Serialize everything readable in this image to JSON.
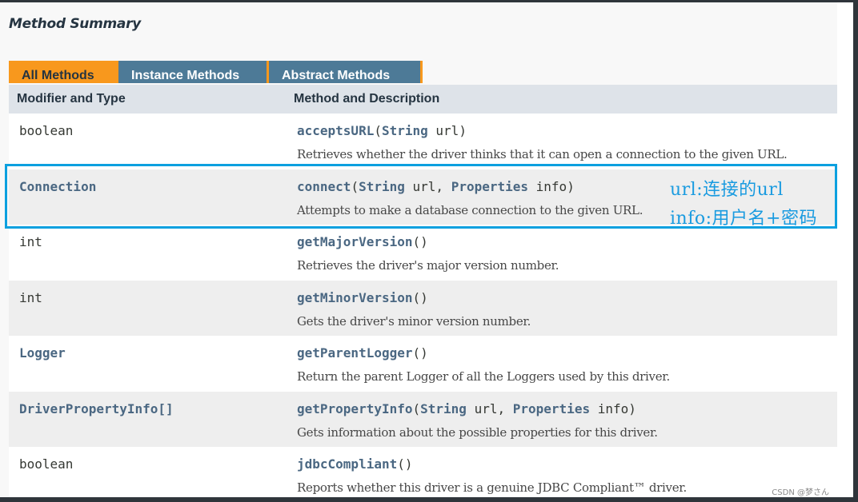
{
  "section": {
    "title": "Method Summary"
  },
  "tabs": [
    {
      "label": "All Methods",
      "active": true
    },
    {
      "label": "Instance Methods",
      "active": false
    },
    {
      "label": "Abstract Methods",
      "active": false
    }
  ],
  "table": {
    "headers": [
      "Modifier and Type",
      "Method and Description"
    ],
    "rows": [
      {
        "type": "boolean",
        "type_is_link": false,
        "method": "acceptsURL",
        "params": [
          [
            "String",
            "url"
          ]
        ],
        "description": "Retrieves whether the driver thinks that it can open a connection to the given URL."
      },
      {
        "type": "Connection",
        "type_is_link": true,
        "method": "connect",
        "params": [
          [
            "String",
            "url"
          ],
          [
            "Properties",
            "info"
          ]
        ],
        "description": "Attempts to make a database connection to the given URL."
      },
      {
        "type": "int",
        "type_is_link": false,
        "method": "getMajorVersion",
        "params": [],
        "description": "Retrieves the driver's major version number."
      },
      {
        "type": "int",
        "type_is_link": false,
        "method": "getMinorVersion",
        "params": [],
        "description": "Gets the driver's minor version number."
      },
      {
        "type": "Logger",
        "type_is_link": true,
        "method": "getParentLogger",
        "params": [],
        "description": "Return the parent Logger of all the Loggers used by this driver."
      },
      {
        "type": "DriverPropertyInfo[]",
        "type_is_link": true,
        "method": "getPropertyInfo",
        "params": [
          [
            "String",
            "url"
          ],
          [
            "Properties",
            "info"
          ]
        ],
        "description": "Gets information about the possible properties for this driver."
      },
      {
        "type": "boolean",
        "type_is_link": false,
        "method": "jdbcCompliant",
        "params": [],
        "description": "Reports whether this driver is a genuine JDBC Compliant™ driver."
      }
    ]
  },
  "annotation": {
    "line1": "url:连接的url",
    "line2": "info:用户名+密码",
    "color": "#0ca0df"
  },
  "watermark": "CSDN @梦さん",
  "colors": {
    "tab_active": "#f8981d",
    "tab_inactive": "#4d7a97",
    "header_bg": "#dee3e9",
    "link": "#4a6782"
  }
}
